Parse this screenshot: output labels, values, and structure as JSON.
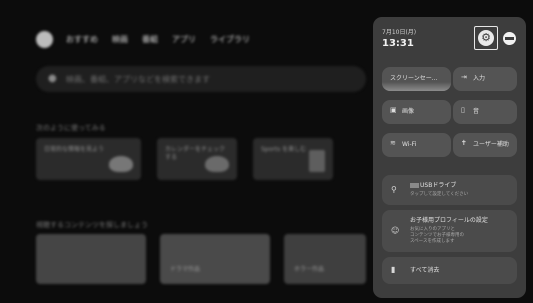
{
  "home": {
    "nav": [
      "おすすめ",
      "映画",
      "番組",
      "アプリ",
      "ライブラリ"
    ],
    "search_placeholder": "映画、番組、アプリなどを検索できます",
    "section1": "次のように使ってみる",
    "cards": [
      {
        "label": "日常的な情報を見よう"
      },
      {
        "label": "カレンダーをチェックする"
      },
      {
        "label": "Sports を楽しむ"
      }
    ],
    "section2": "視聴するコンテンツを探しましょう",
    "thumbs": [
      {
        "label": ""
      },
      {
        "label": "ドラマ作品"
      },
      {
        "label": "ホラー作品"
      }
    ]
  },
  "panel": {
    "date": "7月10日(月)",
    "time": "13:31",
    "settings_icon": "gear-icon",
    "profile_icon": "avatar-icon",
    "tiles": [
      {
        "icon": "screensaver",
        "label": "スクリーンセー..."
      },
      {
        "icon": "input-icon",
        "glyph": "⇥",
        "label": "入力"
      },
      {
        "icon": "picture-icon",
        "glyph": "▣",
        "label": "画像"
      },
      {
        "icon": "sound-icon",
        "glyph": "▯",
        "label": "音"
      },
      {
        "icon": "wifi-icon",
        "glyph": "≋",
        "label": "Wi-Fi"
      },
      {
        "icon": "accessibility-icon",
        "glyph": "✝",
        "label": "ユーザー補助"
      }
    ],
    "usb": {
      "title": "USBドライブ",
      "subtitle": "タップして設定してください"
    },
    "kids": {
      "title": "お子様用プロフィールの設定",
      "line1": "お気に入りのアプリと",
      "line2": "コンテンツでお子様専用の",
      "line3": "スペースを作成します"
    },
    "clear_all": "すべて消去"
  }
}
